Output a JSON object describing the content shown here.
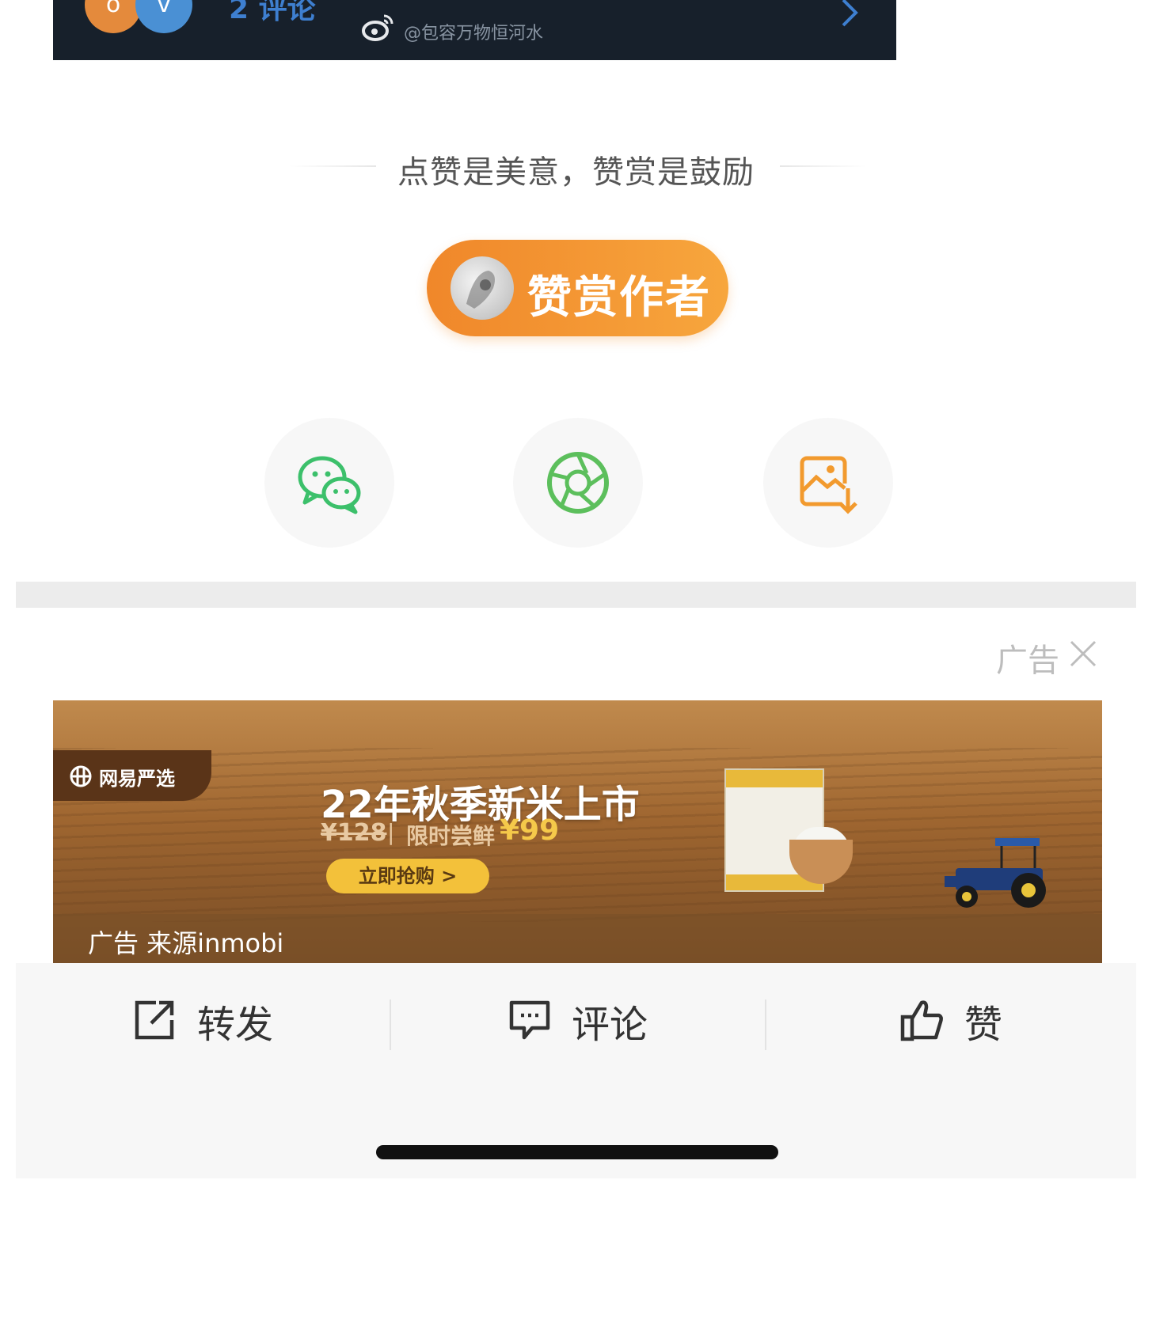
{
  "top_card": {
    "avatar_1": "o",
    "avatar_2": "v",
    "comment_count": "2 评论",
    "weibo_handle": "@包容万物恒河水",
    "icons": {
      "weibo": "weibo-icon",
      "chevron": "chevron-right-icon"
    },
    "accent_color": "#3e7fd0"
  },
  "appreciation": {
    "tagline": "点赞是美意，赞赏是鼓励",
    "reward_button_label": "赞赏作者",
    "button_color": "#f0872a"
  },
  "share": {
    "items": [
      {
        "icon": "wechat-icon"
      },
      {
        "icon": "moments-icon"
      },
      {
        "icon": "save-image-icon"
      }
    ]
  },
  "ad": {
    "flag_label": "广告",
    "close_icon": "close-icon",
    "brand": "网易严选",
    "headline": "22年秋季新米上市",
    "price_old": "¥128",
    "price_sep": "|",
    "price_label": "限时尝鲜",
    "price_new": "¥99",
    "cta_label": "立即抢购 >",
    "source": "广告 来源inmobi"
  },
  "action_bar": {
    "forward_label": "转发",
    "comment_label": "评论",
    "like_label": "赞",
    "icons": {
      "forward": "share-out-icon",
      "comment": "comment-icon",
      "like": "thumbs-up-icon"
    }
  }
}
